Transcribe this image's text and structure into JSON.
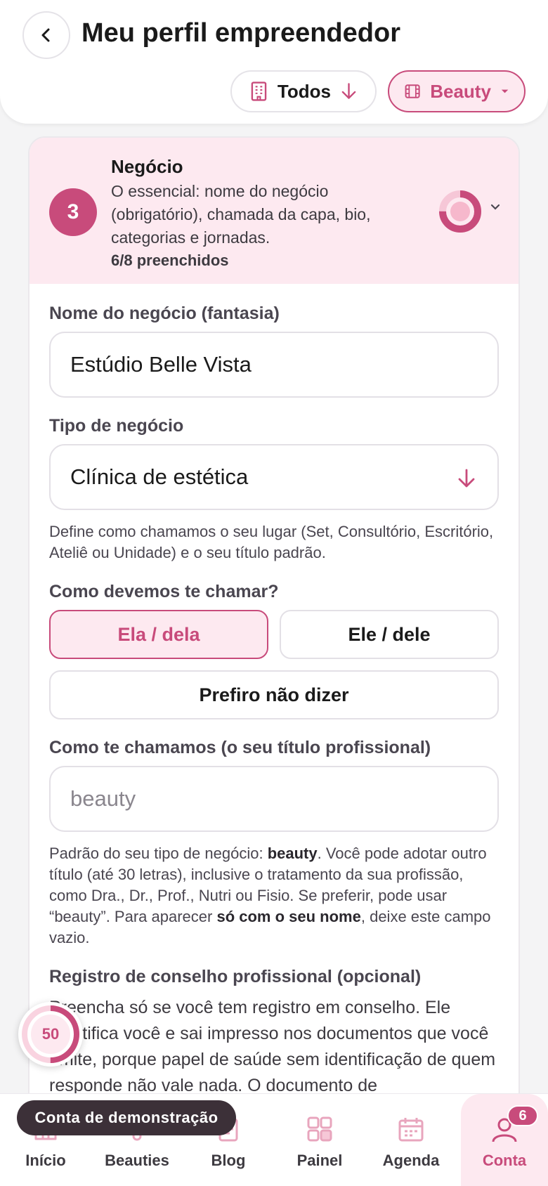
{
  "header": {
    "title": "Meu perfil empreendedor",
    "filter_label": "Todos",
    "category_label": "Beauty"
  },
  "section": {
    "step": "3",
    "title": "Negócio",
    "description": "O essencial: nome do negócio (obrigatório), chamada da capa, bio, categorias e jornadas.",
    "count": "6/8 preenchidos",
    "progress_fraction": 0.75
  },
  "fields": {
    "business_name_label": "Nome do negócio (fantasia)",
    "business_name_value": "Estúdio Belle Vista",
    "business_type_label": "Tipo de negócio",
    "business_type_value": "Clínica de estética",
    "business_type_help": "Define como chamamos o seu lugar (Set, Consultório, Escritório, Ateliê ou Unidade) e o seu título padrão.",
    "pronoun_label": "Como devemos te chamar?",
    "pronoun_options": [
      "Ela / dela",
      "Ele / dele",
      "Prefiro não dizer"
    ],
    "pronoun_selected": "Ela / dela",
    "title_label": "Como te chamamos (o seu título profissional)",
    "title_placeholder": "beauty",
    "title_help_1": "Padrão do seu tipo de negócio: ",
    "title_help_bold_1": "beauty",
    "title_help_2": ". Você pode adotar outro título (até 30 letras), inclusive o tratamento da sua profissão, como Dra., Dr., Prof., Nutri ou Fisio. Se preferir, pode usar “beauty”. Para aparecer ",
    "title_help_bold_2": "só com o seu nome",
    "title_help_3": ", deixe este campo vazio.",
    "registry_label": "Registro de conselho profissional (opcional)",
    "registry_text": "Preencha só se você tem registro em conselho. Ele identifica você e sai impresso nos documentos que você emite, porque papel de saúde sem identificação de quem responde não vale nada. O documento de"
  },
  "progress_badge": {
    "value": "50",
    "fraction": 0.5
  },
  "demo_badge": "Conta de demonstração",
  "nav": {
    "items": [
      {
        "label": "Início",
        "icon": "home-icon"
      },
      {
        "label": "Beauties",
        "icon": "beauties-icon"
      },
      {
        "label": "Blog",
        "icon": "blog-icon"
      },
      {
        "label": "Painel",
        "icon": "dashboard-icon"
      },
      {
        "label": "Agenda",
        "icon": "calendar-icon"
      },
      {
        "label": "Conta",
        "icon": "user-icon"
      }
    ],
    "active": "Conta",
    "account_badge": "6"
  },
  "colors": {
    "accent": "#c84b7b",
    "accent_light": "#fde9f0",
    "background": "#f4f4f5"
  }
}
